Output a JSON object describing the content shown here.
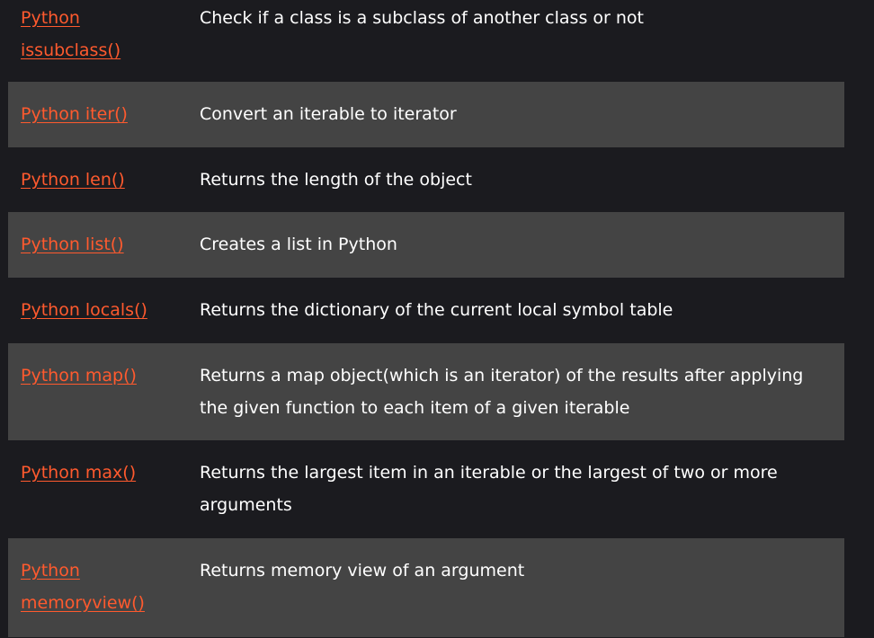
{
  "rows": [
    {
      "func": "Python issubclass()",
      "desc": "Check if a class is a subclass of another class or not"
    },
    {
      "func": "Python iter()",
      "desc": "Convert an iterable to iterator"
    },
    {
      "func": "Python len()",
      "desc": "Returns the length of the object"
    },
    {
      "func": "Python list()",
      "desc": "Creates a list in Python"
    },
    {
      "func": "Python locals()",
      "desc": "Returns the dictionary of the current local symbol table"
    },
    {
      "func": "Python map()",
      "desc": "Returns a map object(which is an iterator) of the results after applying the given function to each item of a given iterable"
    },
    {
      "func": "Python max()",
      "desc": "Returns the largest item in an iterable or the largest of two or more arguments"
    },
    {
      "func": "Python memoryview()",
      "desc": "Returns memory view of an argument"
    }
  ],
  "colors": {
    "page_bg": "#1b1b1f",
    "alt_row_bg": "#444444",
    "link": "#ff5a2e",
    "text": "#ffffff"
  }
}
